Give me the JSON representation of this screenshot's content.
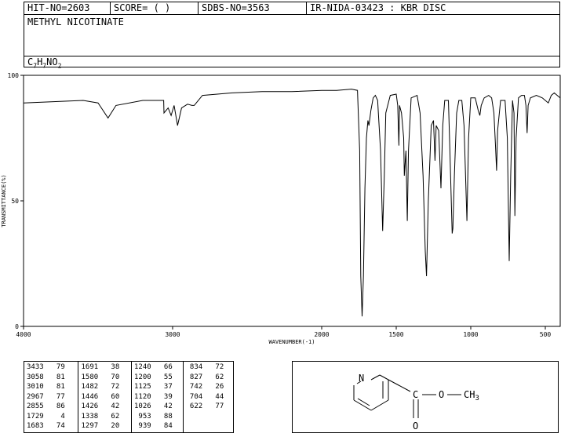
{
  "header": {
    "hit_no": "HIT-NO=2603",
    "score": "SCORE=  (   )",
    "sdbs_no": "SDBS-NO=3563",
    "ir_no": "IR-NIDA-03423 : KBR DISC",
    "compound_name": "METHYL NICOTINATE",
    "formula": {
      "c": "C",
      "c_n": "7",
      "h": "H",
      "h_n": "7",
      "n": "N",
      "o": "O",
      "o_n": "2"
    }
  },
  "chart_data": {
    "type": "line",
    "xlabel": "WAVENUMBER(-1)",
    "ylabel": "TRANSMITTANCE(%)",
    "xlim": [
      4000,
      400
    ],
    "ylim": [
      0,
      100
    ],
    "x_ticks": [
      4000,
      3000,
      2000,
      1500,
      1000,
      500
    ],
    "y_ticks": [
      0,
      50,
      100
    ],
    "grid": false,
    "series": [
      {
        "values": [
          [
            4000,
            89
          ],
          [
            3800,
            89.5
          ],
          [
            3600,
            90
          ],
          [
            3500,
            89
          ],
          [
            3433,
            83
          ],
          [
            3380,
            88
          ],
          [
            3200,
            90
          ],
          [
            3060,
            90
          ],
          [
            3058,
            85
          ],
          [
            3030,
            87
          ],
          [
            3010,
            84
          ],
          [
            2990,
            88
          ],
          [
            2967,
            80
          ],
          [
            2940,
            87
          ],
          [
            2900,
            88.5
          ],
          [
            2870,
            88
          ],
          [
            2855,
            88
          ],
          [
            2800,
            92
          ],
          [
            2600,
            93
          ],
          [
            2400,
            93.5
          ],
          [
            2200,
            93.5
          ],
          [
            2000,
            94
          ],
          [
            1900,
            94
          ],
          [
            1800,
            94.5
          ],
          [
            1760,
            94
          ],
          [
            1745,
            70
          ],
          [
            1738,
            20
          ],
          [
            1729,
            4
          ],
          [
            1720,
            20
          ],
          [
            1710,
            55
          ],
          [
            1700,
            75
          ],
          [
            1690,
            82
          ],
          [
            1683,
            80
          ],
          [
            1670,
            86
          ],
          [
            1655,
            91
          ],
          [
            1640,
            92
          ],
          [
            1625,
            90
          ],
          [
            1605,
            70
          ],
          [
            1591,
            38
          ],
          [
            1580,
            60
          ],
          [
            1570,
            85
          ],
          [
            1540,
            92
          ],
          [
            1500,
            92.5
          ],
          [
            1490,
            88
          ],
          [
            1482,
            72
          ],
          [
            1478,
            88
          ],
          [
            1465,
            85
          ],
          [
            1450,
            75
          ],
          [
            1446,
            60
          ],
          [
            1435,
            70
          ],
          [
            1426,
            42
          ],
          [
            1418,
            70
          ],
          [
            1400,
            91
          ],
          [
            1360,
            92
          ],
          [
            1340,
            85
          ],
          [
            1320,
            60
          ],
          [
            1305,
            30
          ],
          [
            1297,
            20
          ],
          [
            1285,
            50
          ],
          [
            1265,
            80
          ],
          [
            1250,
            82
          ],
          [
            1240,
            66
          ],
          [
            1232,
            80
          ],
          [
            1215,
            78
          ],
          [
            1200,
            55
          ],
          [
            1188,
            80
          ],
          [
            1175,
            90
          ],
          [
            1150,
            90
          ],
          [
            1140,
            70
          ],
          [
            1125,
            37
          ],
          [
            1120,
            39
          ],
          [
            1110,
            60
          ],
          [
            1095,
            85
          ],
          [
            1080,
            90
          ],
          [
            1060,
            90
          ],
          [
            1045,
            80
          ],
          [
            1026,
            42
          ],
          [
            1015,
            75
          ],
          [
            1000,
            91
          ],
          [
            970,
            91
          ],
          [
            950,
            86
          ],
          [
            939,
            84
          ],
          [
            930,
            88
          ],
          [
            910,
            91
          ],
          [
            880,
            92
          ],
          [
            860,
            91
          ],
          [
            845,
            85
          ],
          [
            834,
            72
          ],
          [
            827,
            62
          ],
          [
            820,
            78
          ],
          [
            800,
            90
          ],
          [
            770,
            90
          ],
          [
            755,
            75
          ],
          [
            742,
            26
          ],
          [
            732,
            60
          ],
          [
            720,
            90
          ],
          [
            710,
            85
          ],
          [
            704,
            44
          ],
          [
            696,
            75
          ],
          [
            680,
            91
          ],
          [
            660,
            92
          ],
          [
            640,
            92
          ],
          [
            630,
            88
          ],
          [
            622,
            77
          ],
          [
            615,
            88
          ],
          [
            600,
            91
          ],
          [
            560,
            92
          ],
          [
            520,
            91
          ],
          [
            500,
            90
          ],
          [
            480,
            89
          ],
          [
            460,
            92
          ],
          [
            440,
            93
          ],
          [
            420,
            92
          ],
          [
            400,
            91
          ]
        ]
      }
    ],
    "peak_table": [
      [
        3433,
        79
      ],
      [
        3058,
        81
      ],
      [
        3010,
        81
      ],
      [
        2967,
        77
      ],
      [
        2855,
        86
      ],
      [
        1729,
        4
      ],
      [
        1683,
        74
      ],
      [
        1691,
        38
      ],
      [
        1580,
        70
      ],
      [
        1482,
        72
      ],
      [
        1446,
        60
      ],
      [
        1426,
        42
      ],
      [
        1338,
        62
      ],
      [
        1297,
        20
      ],
      [
        1240,
        66
      ],
      [
        1200,
        55
      ],
      [
        1125,
        37
      ],
      [
        1120,
        39
      ],
      [
        1026,
        42
      ],
      [
        953,
        88
      ],
      [
        939,
        84
      ],
      [
        834,
        72
      ],
      [
        827,
        62
      ],
      [
        742,
        26
      ],
      [
        704,
        44
      ],
      [
        622,
        77
      ]
    ]
  },
  "structure": {
    "ring_n": "N",
    "c": "C",
    "o": "O",
    "ch": "CH",
    "ch_sub": "3",
    "carbonyl_o": "O"
  }
}
